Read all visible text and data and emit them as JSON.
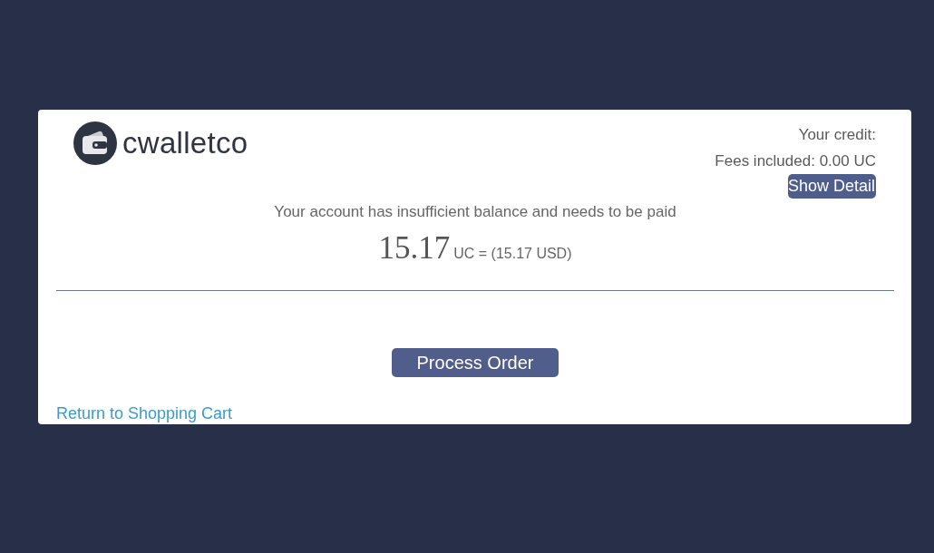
{
  "logo": {
    "text": "cwalletco"
  },
  "credit": {
    "label": "Your credit:",
    "fees": "Fees included: 0.00 UC",
    "detail_button": "Show Detail"
  },
  "message": "Your account has insufficient balance and needs to be paid",
  "amount": {
    "value": "15.17",
    "conversion": "UC = (15.17 USD)"
  },
  "primary_button": "Process Order",
  "back_link": "Return to Shopping Cart"
}
